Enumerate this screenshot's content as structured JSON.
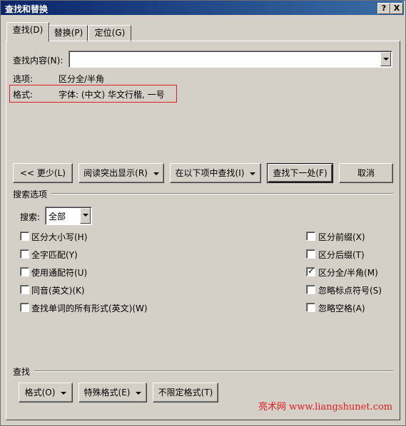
{
  "window": {
    "title": "查找和替换",
    "help_button": "?",
    "close_button": "X"
  },
  "tabs": [
    {
      "label": "查找(D)",
      "active": true
    },
    {
      "label": "替换(P)",
      "active": false
    },
    {
      "label": "定位(G)",
      "active": false
    }
  ],
  "find": {
    "label": "查找内容(N):",
    "value": ""
  },
  "info": {
    "options_label": "选项:",
    "options_value": "区分全/半角",
    "format_label": "格式:",
    "format_value": "字体: (中文) 华文行楷, 一号"
  },
  "buttons": {
    "less": "<< 更少(L)",
    "reading_highlight": "阅读突出显示(R)",
    "find_in": "在以下项中查找(I)",
    "find_next": "查找下一处(F)",
    "cancel": "取消"
  },
  "search_options": {
    "group_label": "搜索选项",
    "search_label": "搜索:",
    "search_value": "全部",
    "left": [
      {
        "label": "区分大小写(H)",
        "checked": false
      },
      {
        "label": "全字匹配(Y)",
        "checked": false
      },
      {
        "label": "使用通配符(U)",
        "checked": false
      },
      {
        "label": "同音(英文)(K)",
        "checked": false
      },
      {
        "label": "查找单词的所有形式(英文)(W)",
        "checked": false
      }
    ],
    "right": [
      {
        "label": "区分前缀(X)",
        "checked": false
      },
      {
        "label": "区分后缀(T)",
        "checked": false
      },
      {
        "label": "区分全/半角(M)",
        "checked": true
      },
      {
        "label": "忽略标点符号(S)",
        "checked": false
      },
      {
        "label": "忽略空格(A)",
        "checked": false
      }
    ]
  },
  "find_group": {
    "label": "查找",
    "format_button": "格式(O)",
    "special_button": "特殊格式(E)",
    "no_format_button": "不限定格式(T)"
  },
  "watermark": "亮术网 www.liangshunet.com"
}
